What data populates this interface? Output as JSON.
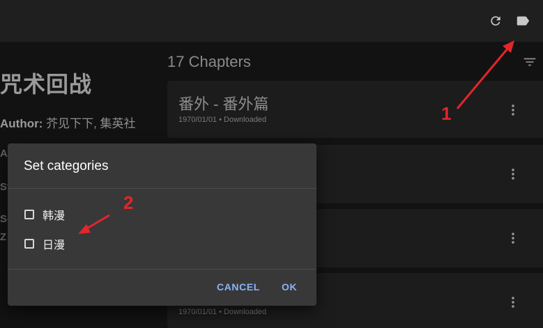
{
  "topbar": {
    "refresh_icon": "refresh-icon",
    "label_icon": "label-icon"
  },
  "manga": {
    "title": "咒术回战",
    "author_label": "Author:",
    "author_value": " 芥见下下, 集英社",
    "fragments": [
      "Ar",
      "St",
      "Sc",
      "Z"
    ]
  },
  "chapters": {
    "header": "17 Chapters",
    "items": [
      {
        "title": "番外 - 番外篇",
        "meta": "1970/01/01 • Downloaded"
      },
      {
        "title": "",
        "meta": ""
      },
      {
        "title": "",
        "meta": ""
      },
      {
        "title": "",
        "meta": "1970/01/01 • Downloaded"
      }
    ]
  },
  "dialog": {
    "title": "Set categories",
    "options": [
      {
        "label": "韩漫",
        "checked": false
      },
      {
        "label": "日漫",
        "checked": false
      }
    ],
    "cancel": "CANCEL",
    "ok": "OK"
  },
  "annotations": {
    "one": "1",
    "two": "2",
    "color": "#e4252b"
  },
  "colors": {
    "accent": "#8ab4f8",
    "dialog_bg": "#383838",
    "app_bg": "#121212"
  }
}
